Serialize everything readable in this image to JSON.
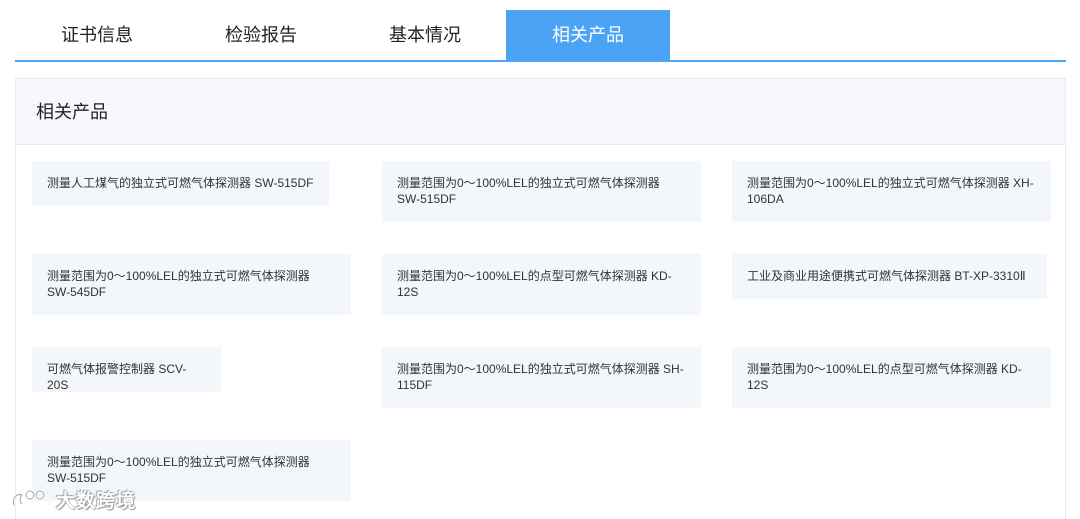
{
  "tabs": [
    {
      "label": "证书信息",
      "active": false
    },
    {
      "label": "检验报告",
      "active": false
    },
    {
      "label": "基本情况",
      "active": false
    },
    {
      "label": "相关产品",
      "active": true
    }
  ],
  "panel": {
    "title": "相关产品",
    "products": [
      "测量人工煤气的独立式可燃气体探测器 SW-515DF",
      "测量范围为0～100%LEL的独立式可燃气体探测器 SW-515DF",
      "测量范围为0～100%LEL的独立式可燃气体探测器 XH-106DA",
      "测量范围为0～100%LEL的独立式可燃气体探测器 SW-545DF",
      "测量范围为0～100%LEL的点型可燃气体探测器 KD-12S",
      "工业及商业用途便携式可燃气体探测器 BT-XP-3310Ⅱ",
      "可燃气体报警控制器 SCV-20S",
      "测量范围为0～100%LEL的独立式可燃气体探测器 SH-115DF",
      "测量范围为0～100%LEL的点型可燃气体探测器 KD-12S",
      "测量范围为0～100%LEL的独立式可燃气体探测器 SW-515DF"
    ]
  },
  "watermark": {
    "text": "大数跨境",
    "icon": "watermark-logo-icon"
  },
  "colors": {
    "accent": "#4ba3f5",
    "card_bg": "#f3f6fa",
    "header_bg": "#f6f8fb"
  }
}
